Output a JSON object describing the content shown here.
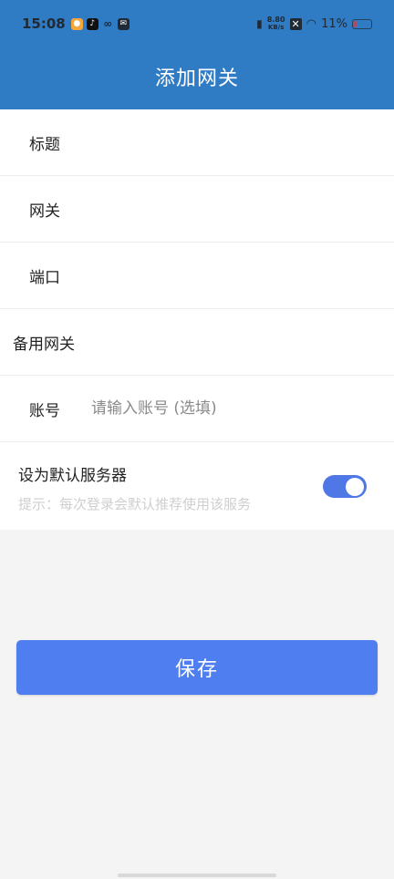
{
  "status_bar": {
    "time": "15:08",
    "network_speed_value": "8.80",
    "network_speed_unit": "KB/s",
    "battery": "11%"
  },
  "header": {
    "title": "添加网关"
  },
  "form": {
    "title_label": "标题",
    "gateway_label": "网关",
    "port_label": "端口",
    "backup_gateway_label": "备用网关",
    "account_label": "账号",
    "account_placeholder": "请输入账号 (选填)"
  },
  "default_server": {
    "title": "设为默认服务器",
    "hint": "提示：每次登录会默认推荐使用该服务",
    "enabled": true
  },
  "save_button": {
    "label": "保存"
  },
  "colors": {
    "header_bg": "#2f7bc4",
    "button_bg": "#4f7ef1",
    "toggle_on": "#4f78e6"
  }
}
